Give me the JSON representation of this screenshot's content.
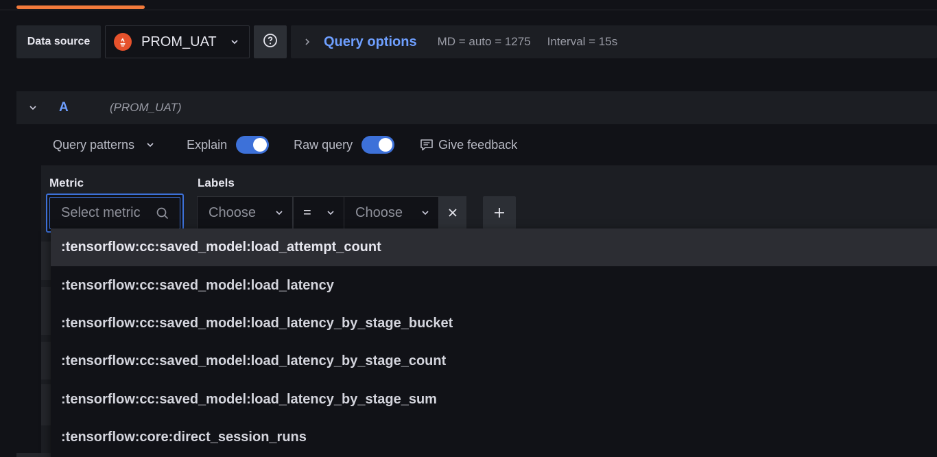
{
  "datasource": {
    "label": "Data source",
    "selected": "PROM_UAT",
    "logo_color": "#e6522c"
  },
  "query_options": {
    "title": "Query options",
    "md": "MD = auto = 1275",
    "interval": "Interval = 15s"
  },
  "query": {
    "ref_id": "A",
    "datasource_name": "(PROM_UAT)"
  },
  "toolbar": {
    "query_patterns": "Query patterns",
    "explain": "Explain",
    "raw_query": "Raw query",
    "give_feedback": "Give feedback",
    "explain_enabled": true,
    "raw_query_enabled": true
  },
  "builder": {
    "metric_label": "Metric",
    "metric_placeholder": "Select metric",
    "labels_label": "Labels",
    "label_key": "Choose",
    "label_operator": "=",
    "label_value": "Choose"
  },
  "metric_options": [
    ":tensorflow:cc:saved_model:load_attempt_count",
    ":tensorflow:cc:saved_model:load_latency",
    ":tensorflow:cc:saved_model:load_latency_by_stage_bucket",
    ":tensorflow:cc:saved_model:load_latency_by_stage_count",
    ":tensorflow:cc:saved_model:load_latency_by_stage_sum",
    ":tensorflow:core:direct_session_runs"
  ],
  "colors": {
    "accent_blue": "#6e9fff",
    "toggle_on": "#3d71d9",
    "tab_active": "#f27a3b"
  }
}
